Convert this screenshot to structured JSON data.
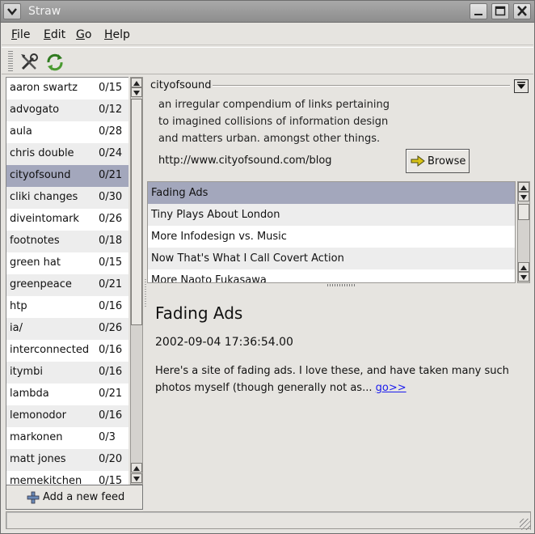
{
  "window": {
    "title": "Straw"
  },
  "menubar": {
    "items": [
      {
        "label": "File",
        "accel": "F",
        "rest": "ile"
      },
      {
        "label": "Edit",
        "accel": "E",
        "rest": "dit"
      },
      {
        "label": "Go",
        "accel": "G",
        "rest": "o"
      },
      {
        "label": "Help",
        "accel": "H",
        "rest": "elp"
      }
    ]
  },
  "toolbar": {
    "icons": [
      "preferences-tools-icon",
      "refresh-icon"
    ]
  },
  "feeds": [
    {
      "name": "aaron swartz",
      "count": "0/15"
    },
    {
      "name": "advogato",
      "count": "0/12"
    },
    {
      "name": "aula",
      "count": "0/28"
    },
    {
      "name": "chris double",
      "count": "0/24"
    },
    {
      "name": "cityofsound",
      "count": "0/21",
      "selected": true
    },
    {
      "name": "cliki changes",
      "count": "0/30"
    },
    {
      "name": "diveintomark",
      "count": "0/26"
    },
    {
      "name": "footnotes",
      "count": "0/18"
    },
    {
      "name": "green hat",
      "count": "0/15"
    },
    {
      "name": "greenpeace",
      "count": "0/21"
    },
    {
      "name": "htp",
      "count": "0/16"
    },
    {
      "name": "ia/",
      "count": "0/26"
    },
    {
      "name": "interconnected",
      "count": "0/16"
    },
    {
      "name": "itymbi",
      "count": "0/16"
    },
    {
      "name": "lambda",
      "count": "0/21"
    },
    {
      "name": "lemonodor",
      "count": "0/16"
    },
    {
      "name": "markonen",
      "count": "0/3"
    },
    {
      "name": "matt jones",
      "count": "0/20"
    },
    {
      "name": "memekitchen",
      "count": "0/15"
    }
  ],
  "add_feed_button": {
    "label": "Add a new feed"
  },
  "feed_info": {
    "name": "cityofsound",
    "description": "an irregular compendium of links pertaining to imagined collisions of information design and matters urban. amongst other things.",
    "url": "http://www.cityofsound.com/blog",
    "browse_label": "Browse"
  },
  "items": [
    {
      "title": "Fading Ads",
      "selected": true
    },
    {
      "title": "Tiny Plays About London"
    },
    {
      "title": "More Infodesign vs. Music"
    },
    {
      "title": "Now That's What I Call Covert Action"
    },
    {
      "title": "More Naoto Fukasawa"
    }
  ],
  "article": {
    "title": "Fading Ads",
    "date": "2002-09-04 17:36:54.00",
    "body": "Here's a site of fading ads. I love these, and have taken many such photos myself (though generally not as...",
    "link_text": "go>>"
  },
  "status": {
    "text": ""
  }
}
